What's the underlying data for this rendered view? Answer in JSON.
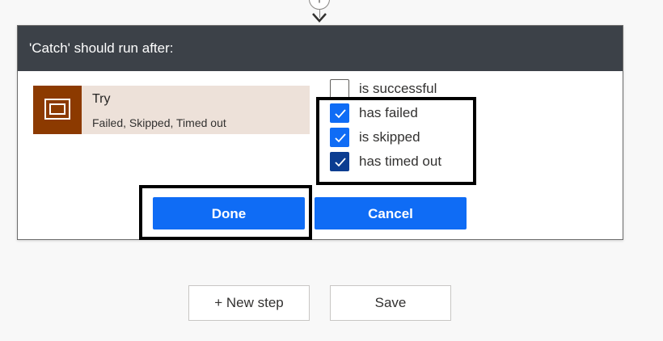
{
  "connector": {
    "add_symbol": "+"
  },
  "dialog": {
    "title": "'Catch' should run after:",
    "action": {
      "title": "Try",
      "subtitle": "Failed, Skipped, Timed out",
      "icon": "scope-icon",
      "icon_color": "#8c3a00",
      "card_color": "#ede1d9"
    },
    "options": [
      {
        "label": "is successful",
        "checked": false
      },
      {
        "label": "has failed",
        "checked": true
      },
      {
        "label": "is skipped",
        "checked": true
      },
      {
        "label": "has timed out",
        "checked": true
      }
    ],
    "buttons": {
      "done": "Done",
      "cancel": "Cancel"
    }
  },
  "footer": {
    "new_step": "+ New step",
    "save": "Save"
  },
  "colors": {
    "header_bg": "#3c4148",
    "primary": "#0f6cf5",
    "checkbox_dark": "#0b3d91"
  }
}
